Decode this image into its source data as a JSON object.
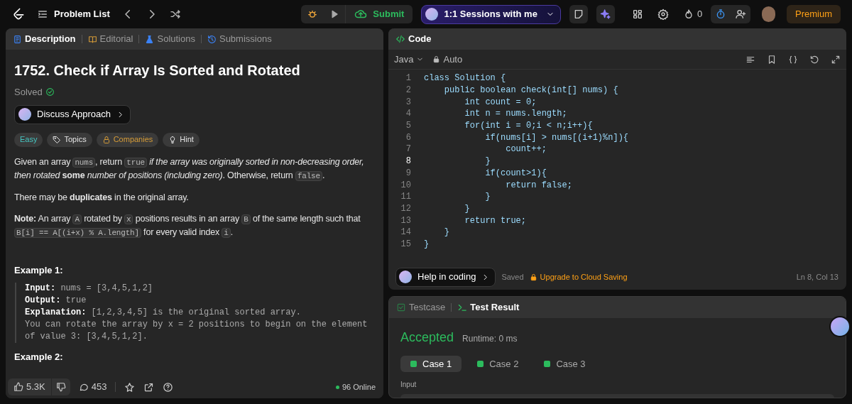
{
  "topbar": {
    "problem_list": "Problem List",
    "submit": "Submit",
    "sessions": "1:1 Sessions with me",
    "streak": "0",
    "premium": "Premium"
  },
  "left_tabs": [
    {
      "label": "Description",
      "selected": true,
      "kind": "description"
    },
    {
      "label": "Editorial",
      "selected": false,
      "kind": "editorial"
    },
    {
      "label": "Solutions",
      "selected": false,
      "kind": "solutions"
    },
    {
      "label": "Submissions",
      "selected": false,
      "kind": "submissions"
    }
  ],
  "problem": {
    "title": "1752. Check if Array Is Sorted and Rotated",
    "status": "Solved",
    "discuss": "Discuss Approach",
    "tags": [
      {
        "label": "Easy",
        "kind": "difficulty"
      },
      {
        "label": "Topics",
        "kind": "topics"
      },
      {
        "label": "Companies",
        "kind": "companies"
      },
      {
        "label": "Hint",
        "kind": "hint"
      }
    ],
    "paragraphs": [
      [
        {
          "kind": "text",
          "text": "Given an array "
        },
        {
          "kind": "code",
          "text": "nums"
        },
        {
          "kind": "text",
          "text": ", return "
        },
        {
          "kind": "code",
          "text": "true"
        },
        {
          "kind": "text",
          "text": " *if the array was originally sorted in non-decreasing order, then rotated* "
        },
        {
          "kind": "text",
          "text": "**some**"
        },
        {
          "kind": "text",
          "text": " *number of positions (including zero)*. Otherwise, return "
        },
        {
          "kind": "code",
          "text": "false"
        },
        {
          "kind": "text",
          "text": "."
        }
      ],
      [
        {
          "kind": "text",
          "text": "There may be **duplicates** in the original array."
        }
      ],
      [
        {
          "kind": "text",
          "text": "**Note:** An array "
        },
        {
          "kind": "code",
          "text": "A"
        },
        {
          "kind": "text",
          "text": " rotated by "
        },
        {
          "kind": "code",
          "text": "x"
        },
        {
          "kind": "text",
          "text": " positions results in an array "
        },
        {
          "kind": "code",
          "text": "B"
        },
        {
          "kind": "text",
          "text": " of the same length such that "
        },
        {
          "kind": "code",
          "text": "B[i] == A[(i+x) % A.length]"
        },
        {
          "kind": "text",
          "text": " for every valid index "
        },
        {
          "kind": "code",
          "text": "i"
        },
        {
          "kind": "text",
          "text": "."
        }
      ]
    ],
    "examples": [
      {
        "title": "Example 1:",
        "lines": [
          {
            "label": "Input:",
            "text": " nums = [3,4,5,1,2]"
          },
          {
            "label": "Output:",
            "text": " true"
          },
          {
            "label": "Explanation:",
            "text": " [1,2,3,4,5] is the original sorted array."
          },
          {
            "text": "You can rotate the array by x = 2 positions to begin on the element"
          },
          {
            "text": "of value 3: [3,4,5,1,2]."
          }
        ]
      },
      {
        "title": "Example 2:"
      }
    ]
  },
  "footer": {
    "likes": "5.3K",
    "comments": "453",
    "online": "96 Online"
  },
  "code_panel": {
    "title": "Code",
    "language": "Java",
    "mode": "Auto",
    "lines": [
      {
        "number": "1",
        "text": "class Solution {",
        "active": false
      },
      {
        "number": "2",
        "text": "    public boolean check(int[] nums) {",
        "active": false
      },
      {
        "number": "3",
        "text": "        int count = 0;",
        "active": false
      },
      {
        "number": "4",
        "text": "        int n = nums.length;",
        "active": false
      },
      {
        "number": "5",
        "text": "        for(int i = 0;i < n;i++){",
        "active": false
      },
      {
        "number": "6",
        "text": "            if(nums[i] > nums[(i+1)%n]){",
        "active": false
      },
      {
        "number": "7",
        "text": "                count++;",
        "active": false
      },
      {
        "number": "8",
        "text": "            }",
        "active": true
      },
      {
        "number": "9",
        "text": "            if(count>1){",
        "active": false
      },
      {
        "number": "10",
        "text": "                return false;",
        "active": false
      },
      {
        "number": "11",
        "text": "            }",
        "active": false
      },
      {
        "number": "12",
        "text": "        }",
        "active": false
      },
      {
        "number": "13",
        "text": "        return true;",
        "active": false
      },
      {
        "number": "14",
        "text": "    }",
        "active": false
      },
      {
        "number": "15",
        "text": "}",
        "active": false
      }
    ],
    "help": "Help in coding",
    "saved": "Saved",
    "upgrade": "Upgrade to Cloud Saving",
    "cursor": "Ln 8, Col 13"
  },
  "result_panel": {
    "tabs": [
      {
        "label": "Testcase",
        "selected": false,
        "kind": "testcase"
      },
      {
        "label": "Test Result",
        "selected": true,
        "kind": "result"
      }
    ],
    "verdict": "Accepted",
    "runtime": "Runtime: 0 ms",
    "cases": [
      {
        "label": "Case 1",
        "selected": true,
        "passed": true
      },
      {
        "label": "Case 2",
        "selected": false,
        "passed": true
      },
      {
        "label": "Case 3",
        "selected": false,
        "passed": true
      }
    ],
    "input_label": "Input"
  }
}
